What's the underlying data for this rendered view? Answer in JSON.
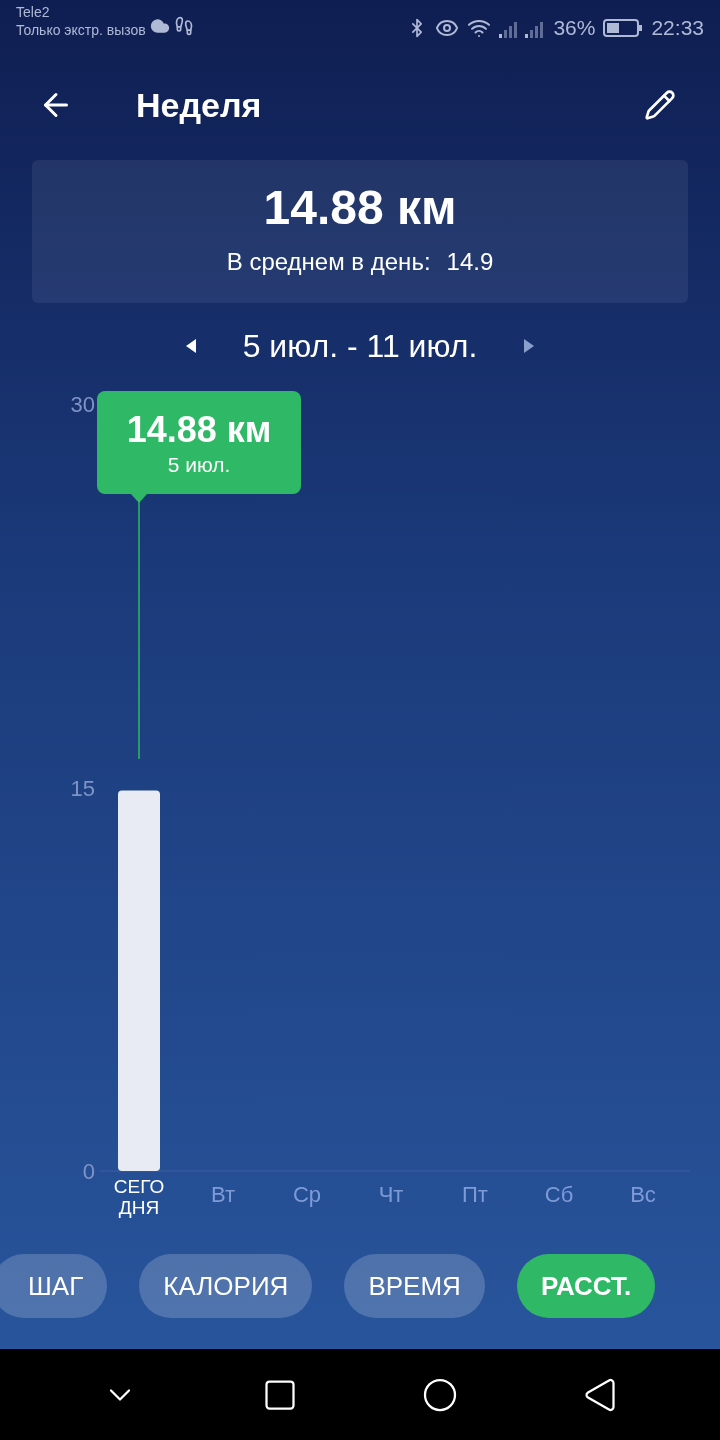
{
  "status_bar": {
    "carrier": "Tele2",
    "network_note": "Только экстр. вызов",
    "battery": "36%",
    "time": "22:33"
  },
  "header": {
    "title": "Неделя"
  },
  "summary": {
    "total": "14.88 км",
    "average_label": "В среднем в день:",
    "average_value": "14.9"
  },
  "period": {
    "label": "5 июл. - 11 июл."
  },
  "chart": {
    "tooltip": {
      "value": "14.88 км",
      "date": "5 июл."
    },
    "chart_data": {
      "type": "bar",
      "categories": [
        "СЕГОДНЯ",
        "Вт",
        "Ср",
        "Чт",
        "Пт",
        "Сб",
        "Вс"
      ],
      "values": [
        14.88,
        null,
        null,
        null,
        null,
        null,
        null
      ],
      "ylim": [
        0,
        30
      ],
      "yticks": [
        0,
        15,
        30
      ]
    }
  },
  "metric_tabs": [
    {
      "label": "ШАГ",
      "selected": false
    },
    {
      "label": "КАЛОРИЯ",
      "selected": false
    },
    {
      "label": "ВРЕМЯ",
      "selected": false
    },
    {
      "label": "РАССТ.",
      "selected": true
    }
  ]
}
